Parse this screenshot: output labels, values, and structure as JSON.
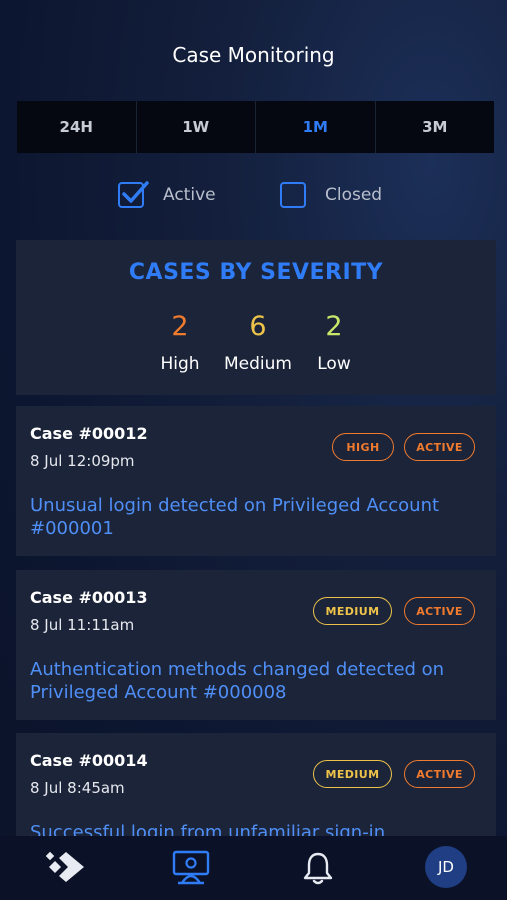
{
  "header": {
    "title": "Case Monitoring"
  },
  "range_tabs": [
    {
      "label": "24H",
      "selected": false
    },
    {
      "label": "1W",
      "selected": false
    },
    {
      "label": "1M",
      "selected": true
    },
    {
      "label": "3M",
      "selected": false
    }
  ],
  "filters": [
    {
      "label": "Active",
      "checked": true
    },
    {
      "label": "Closed",
      "checked": false
    }
  ],
  "severity": {
    "title": "CASES BY SEVERITY",
    "items": [
      {
        "count": "2",
        "label": "High",
        "color": "#f07a2e"
      },
      {
        "count": "6",
        "label": "Medium",
        "color": "#eec34a"
      },
      {
        "count": "2",
        "label": "Low",
        "color": "#c8e66a"
      }
    ]
  },
  "cases": [
    {
      "case_word": "Case",
      "number": "#00012",
      "date": "8 Jul 12:09pm",
      "severity": "HIGH",
      "severity_color": "#f07a2e",
      "status": "ACTIVE",
      "status_color": "#f07a2e",
      "description": "Unusual login detected on Privileged Account #000001"
    },
    {
      "case_word": "Case",
      "number": "#00013",
      "date": "8 Jul 11:11am",
      "severity": "MEDIUM",
      "severity_color": "#eec34a",
      "status": "ACTIVE",
      "status_color": "#f07a2e",
      "description": "Authentication methods changed detected on Privileged Account #000008"
    },
    {
      "case_word": "Case",
      "number": "#00014",
      "date": "8 Jul 8:45am",
      "severity": "MEDIUM",
      "severity_color": "#eec34a",
      "status": "ACTIVE",
      "status_color": "#f07a2e",
      "description": "Successful login from unfamiliar sign-in"
    }
  ],
  "bottom_nav": {
    "items": [
      "logo-icon",
      "monitor-person-icon",
      "bell-icon",
      "avatar"
    ],
    "avatar_initials": "JD",
    "accent": "#2f7cf6"
  }
}
